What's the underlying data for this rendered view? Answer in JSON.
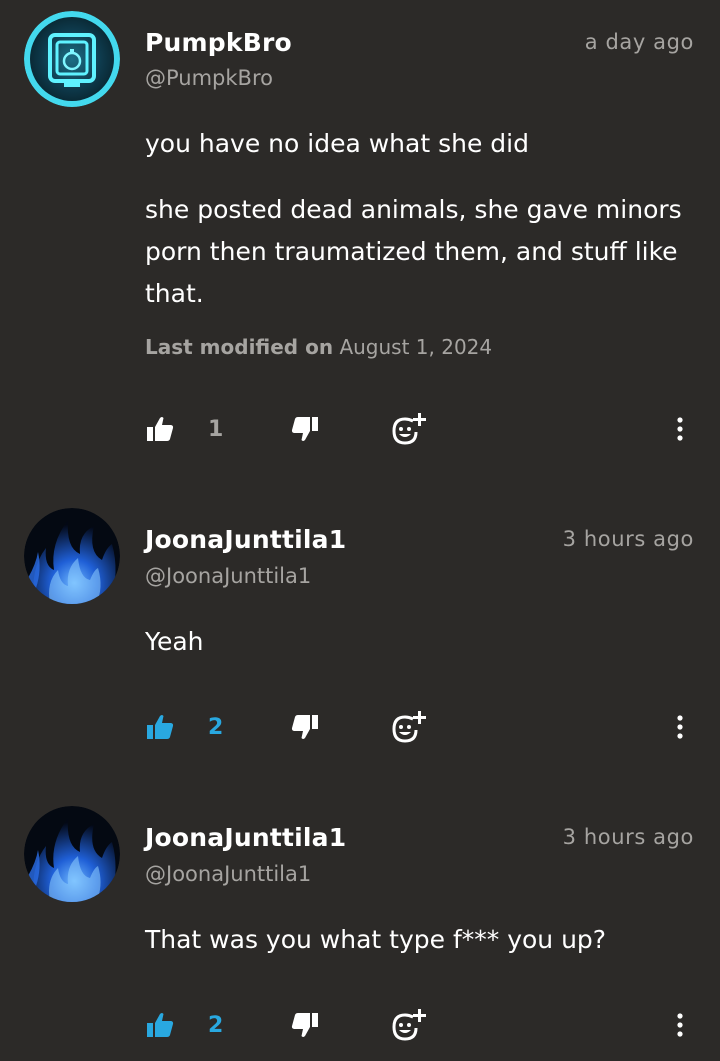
{
  "comments": [
    {
      "author": "PumpkBro",
      "handle": "@PumpkBro",
      "time": "a day ago",
      "avatar_icon": "pumpkin-neon-avatar",
      "paragraphs": [
        "you have no idea what she did",
        "she posted dead animals, she gave minors porn then traumatized them, and stuff like that."
      ],
      "modified_label": "Last modified on",
      "modified_date": "August 1, 2024",
      "likes": "1",
      "liked": false
    },
    {
      "author": "JoonaJunttila1",
      "handle": "@JoonaJunttila1",
      "time": "3 hours ago",
      "avatar_icon": "blue-flame-avatar",
      "paragraphs": [
        "Yeah"
      ],
      "likes": "2",
      "liked": true
    },
    {
      "author": "JoonaJunttila1",
      "handle": "@JoonaJunttila1",
      "time": "3 hours ago",
      "avatar_icon": "blue-flame-avatar",
      "paragraphs": [
        "That was you what type f*** you up?"
      ],
      "likes": "2",
      "liked": true
    }
  ],
  "colors": {
    "background": "#2c2a28",
    "muted_text": "#a6a4a1",
    "accent_blue": "#29a8e0"
  }
}
